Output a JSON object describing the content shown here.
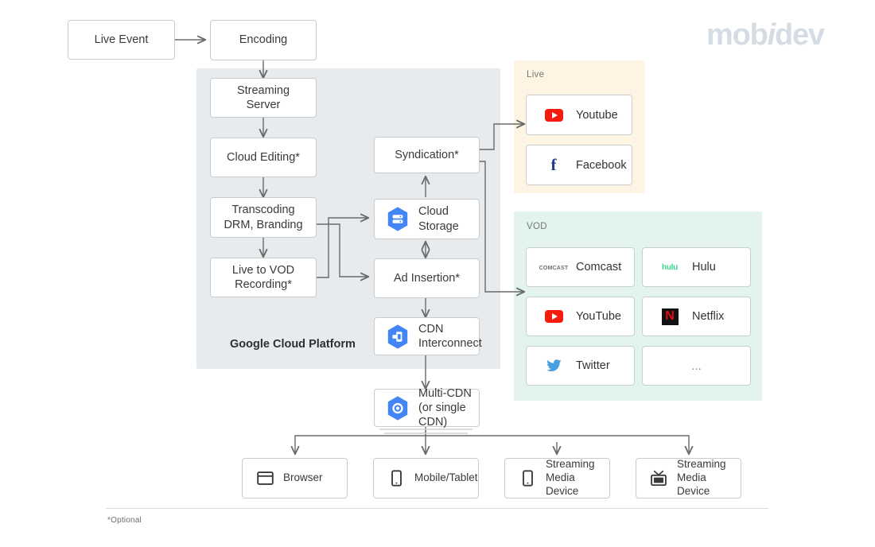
{
  "brand": {
    "name_part1": "mob",
    "name_italic": "i",
    "name_part2": "dev"
  },
  "panels": {
    "gcp": {
      "title": "Google Cloud Platform",
      "bg": "#e7ebee"
    },
    "live": {
      "label": "Live",
      "bg": "#fdf4e3"
    },
    "vod": {
      "label": "VOD",
      "bg": "#e2f4ec"
    }
  },
  "nodes": {
    "live_event": "Live Event",
    "encoding": "Encoding",
    "streaming_server": "Streaming\nServer",
    "cloud_editing": "Cloud Editing*",
    "transcoding": "Transcoding\nDRM, Branding",
    "live_to_vod": "Live to VOD\nRecording*",
    "syndication": "Syndication*",
    "cloud_storage": "Cloud\nStorage",
    "ad_insertion": "Ad Insertion*",
    "cdn_interconnect": "CDN\nInterconnect",
    "multi_cdn": "Multi-CDN\n(or single CDN)"
  },
  "live_platforms": [
    {
      "name": "Youtube",
      "icon": "youtube-icon"
    },
    {
      "name": "Facebook",
      "icon": "facebook-icon"
    }
  ],
  "vod_platforms": [
    {
      "name": "Comcast",
      "icon": "comcast-icon",
      "mark": "COMCAST"
    },
    {
      "name": "Hulu",
      "icon": "hulu-icon",
      "mark": "hulu"
    },
    {
      "name": "YouTube",
      "icon": "youtube-icon"
    },
    {
      "name": "Netflix",
      "icon": "netflix-icon",
      "mark": "N"
    },
    {
      "name": "Twitter",
      "icon": "twitter-icon"
    },
    {
      "name": "...",
      "icon": "ellipsis-icon"
    }
  ],
  "devices": [
    {
      "label": "Browser",
      "icon": "browser-window-icon"
    },
    {
      "label": "Mobile/Tablet",
      "icon": "smartphone-icon"
    },
    {
      "label": "Streaming\nMedia Device",
      "icon": "smartphone-icon"
    },
    {
      "label": "Streaming\nMedia Device",
      "icon": "television-icon"
    }
  ],
  "footer": {
    "note": "*Optional"
  },
  "colors": {
    "gcp_panel": "#e7ebee",
    "live_panel": "#fdf4e3",
    "vod_panel": "#e2f4ec",
    "connector": "#6a6a6a",
    "google_blue": "#4285f4",
    "youtube_red": "#f61c0d",
    "netflix_red": "#e50914",
    "facebook_blue": "#1b3c8c",
    "twitter_blue": "#4a9fe0",
    "hulu_green": "#3dd68c",
    "logo_gray": "#d6dce3"
  }
}
